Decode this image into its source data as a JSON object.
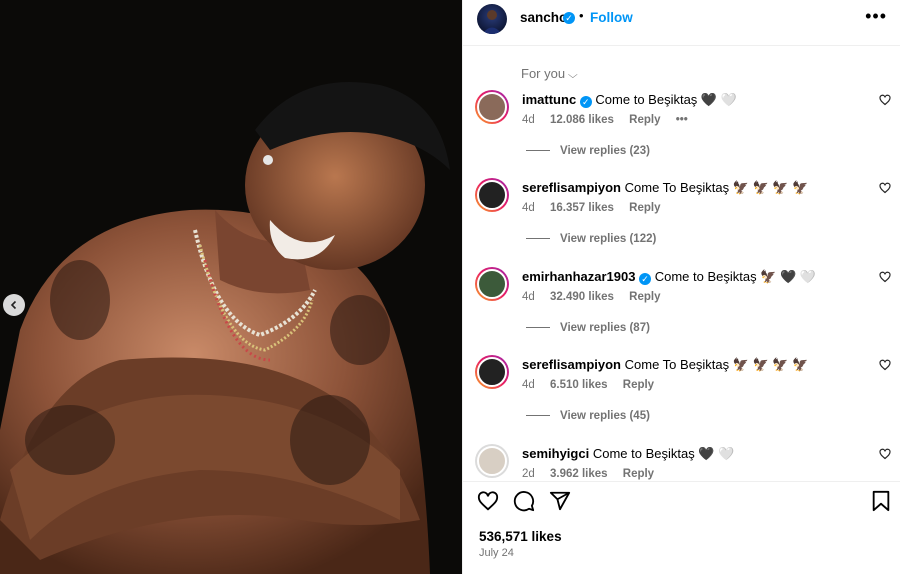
{
  "post": {
    "author": "sancho",
    "follow_label": "Follow",
    "more_label": "•••",
    "dot_separator": "•"
  },
  "comments_header": {
    "sort_label": "For you"
  },
  "comments": [
    {
      "user": "imattunc",
      "verified": true,
      "text": "Come to Beşiktaş 🖤 🤍",
      "age": "4d",
      "likes": "12.086 likes",
      "reply_label": "Reply",
      "options": "•••",
      "view_replies": "View replies (23)"
    },
    {
      "user": "sereflisampiyon",
      "verified": false,
      "text": "Come To Beşiktaş 🦅 🦅 🦅 🦅",
      "age": "4d",
      "likes": "16.357 likes",
      "reply_label": "Reply",
      "view_replies": "View replies (122)"
    },
    {
      "user": "emirhanhazar1903",
      "verified": true,
      "text": "Come to Beşiktaş 🦅 🖤 🤍",
      "age": "4d",
      "likes": "32.490 likes",
      "reply_label": "Reply",
      "view_replies": "View replies (87)"
    },
    {
      "user": "sereflisampiyon",
      "verified": false,
      "text": "Come To Beşiktaş 🦅 🦅 🦅 🦅",
      "age": "4d",
      "likes": "6.510 likes",
      "reply_label": "Reply",
      "view_replies": "View replies (45)"
    },
    {
      "user": "semihyigci",
      "verified": false,
      "text": "Come to Beşiktaş 🖤 🤍",
      "age": "2d",
      "likes": "3.962 likes",
      "reply_label": "Reply"
    }
  ],
  "footer": {
    "total_likes": "536,571 likes",
    "date": "July 24"
  },
  "icons": {
    "like": "heart-icon",
    "comment": "comment-icon",
    "share": "share-icon",
    "save": "bookmark-icon",
    "prev": "chevron-left-icon"
  },
  "colors": {
    "accent": "#0095f6",
    "muted": "#737373",
    "media_bg": "#0b0a08"
  }
}
